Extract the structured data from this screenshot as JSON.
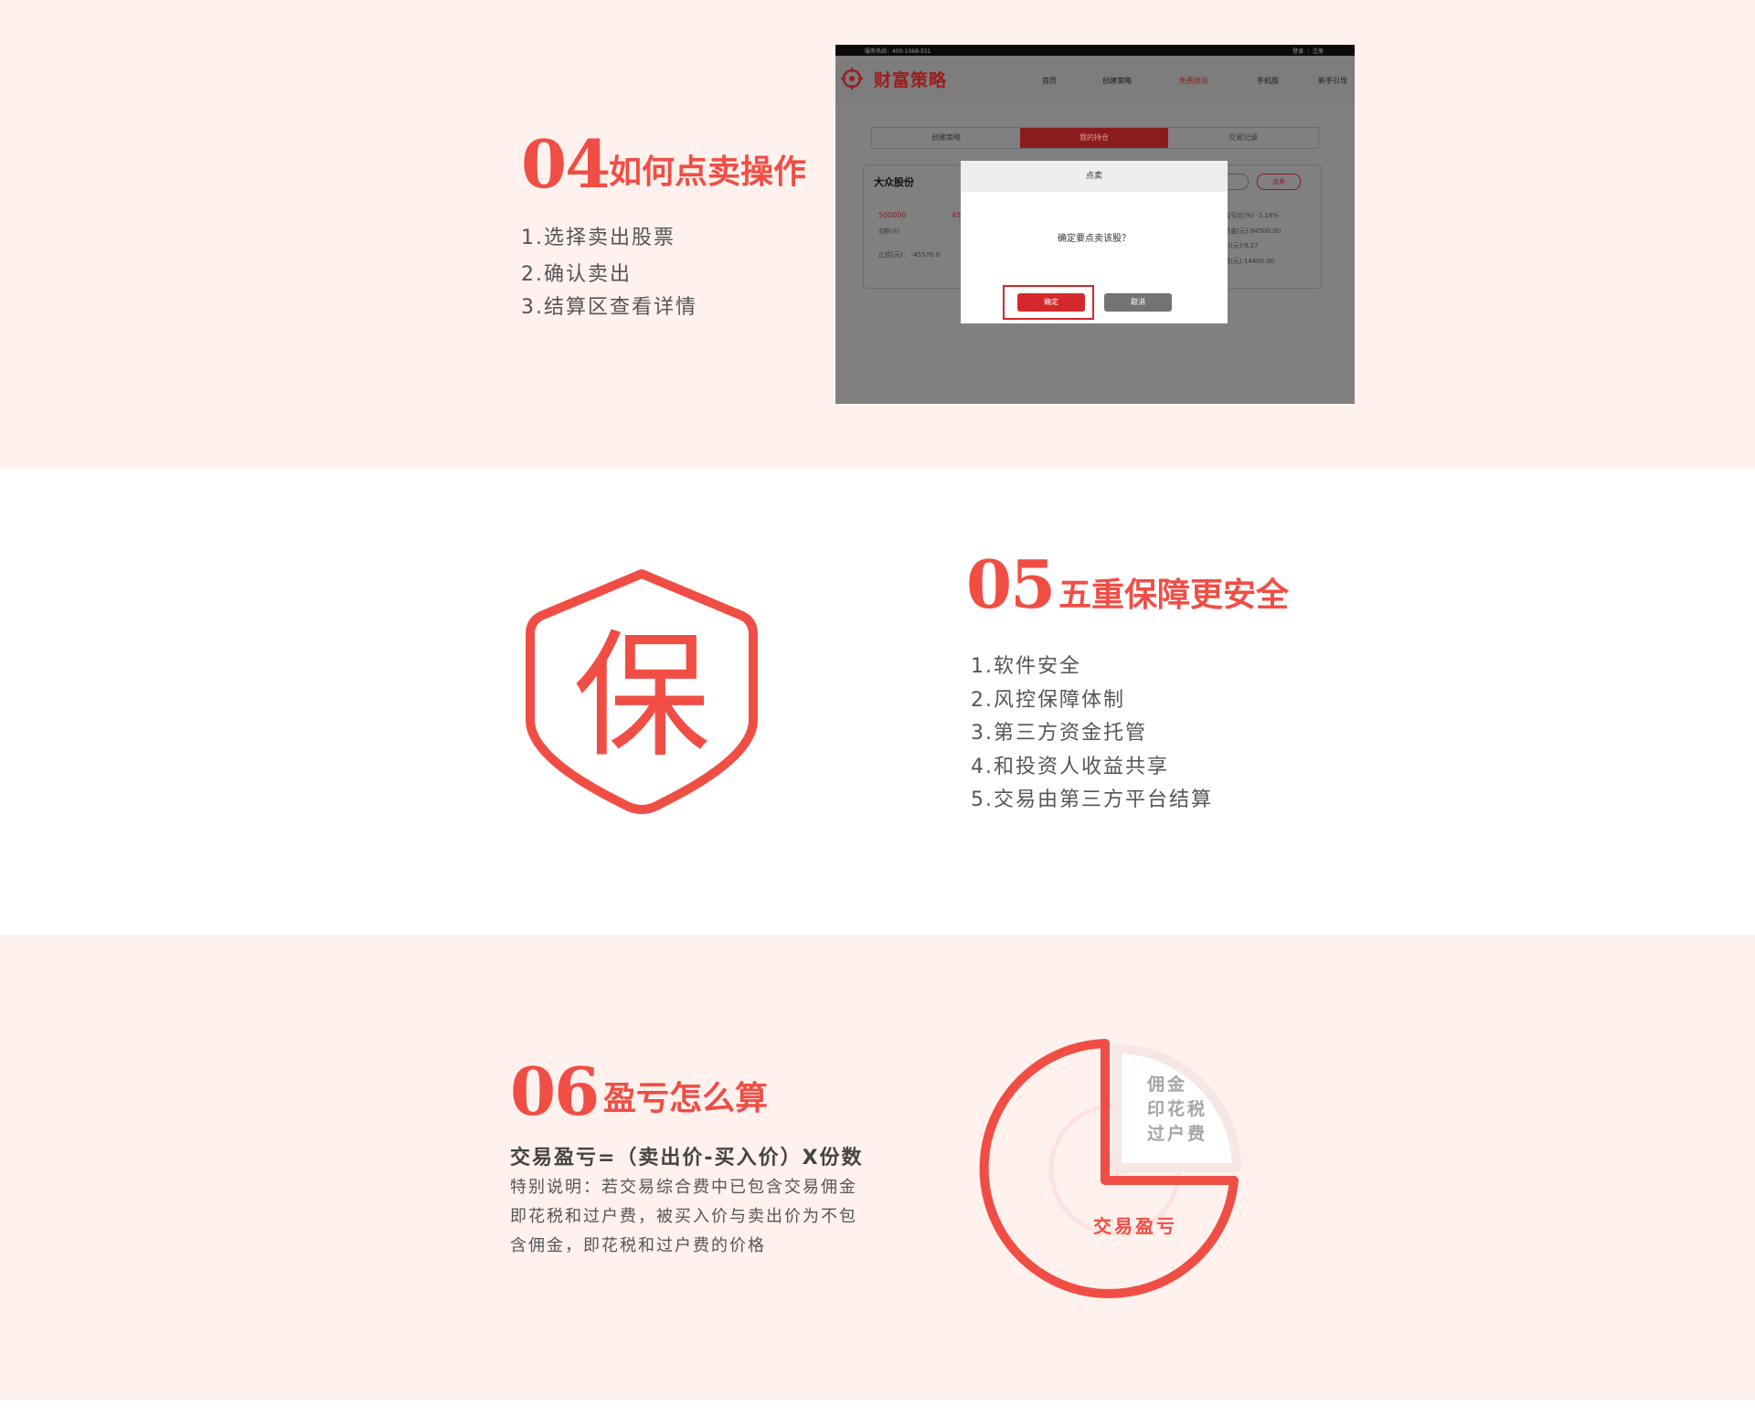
{
  "step4": {
    "number": "04",
    "title": "如何点卖操作",
    "items": [
      "1.选择卖出股票",
      "2.确认卖出",
      "3.结算区查看详情"
    ]
  },
  "screenshot": {
    "hotline": "服务热线：400-1068-551",
    "auth": "登录 ｜ 注册",
    "logo_text": "财富策略",
    "nav": [
      "首页",
      "创建策略",
      "免费体验",
      "手机版",
      "新手引导"
    ],
    "tabs": [
      "创建策略",
      "我的持仓",
      "交易记录"
    ],
    "card": {
      "name": "大众股份",
      "code": "500000",
      "code_suffix": "45",
      "amount_label": "金额(元)",
      "stoploss": "止损(元)： -45570.0",
      "sell_btn": "点卖",
      "r1": "盈亏比(%) -1.18%",
      "r2": "资金(元):64500.00",
      "r3": "价(元):9.27",
      "r4": "费(元):14400.00"
    },
    "modal": {
      "title": "点卖",
      "message": "确定要点卖该股？",
      "confirm": "确定",
      "cancel": "取消"
    }
  },
  "step5": {
    "number": "05",
    "title": "五重保障更安全",
    "shield_char": "保",
    "items": [
      "1.软件安全",
      "2.风控保障体制",
      "3.第三方资金托管",
      "4.和投资人收益共享",
      "5.交易由第三方平台结算"
    ]
  },
  "step6": {
    "number": "06",
    "title": "盈亏怎么算",
    "formula": "交易盈亏=（卖出价-买入价）X份数",
    "note_lines": [
      "特别说明：若交易综合费中已包含交易佣金",
      "即花税和过户费，被买入价与卖出价为不包",
      "含佣金，即花税和过户费的价格"
    ],
    "pie": {
      "slice_labels": [
        "佣金",
        "印花税",
        "过户费"
      ],
      "main_label": "交易盈亏",
      "coin_char": "¥"
    }
  },
  "colors": {
    "accent": "#f04e45",
    "band_bg": "#fff1ee",
    "text": "#555555"
  }
}
